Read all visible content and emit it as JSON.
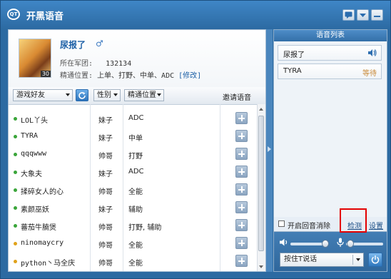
{
  "app": {
    "title": "开黑语音"
  },
  "profile": {
    "name": "尿报了",
    "gender_symbol": "♂",
    "level": "30",
    "team_label": "所在军团:",
    "team_value": "132134",
    "pos_label": "精通位置:",
    "pos_value": "上单、打野、中单、ADC",
    "edit_label": "[修改]"
  },
  "friends_header": {
    "friends_dropdown": "游戏好友",
    "gender_dropdown": "性别",
    "position_dropdown": "精通位置",
    "invite_label": "邀请语音"
  },
  "friends": [
    {
      "name": "LOL丫头",
      "gender": "妹子",
      "position": "ADC",
      "status": "online"
    },
    {
      "name": "TYRA",
      "gender": "妹子",
      "position": "中单",
      "status": "online"
    },
    {
      "name": "qqqwww",
      "gender": "帅哥",
      "position": "打野",
      "status": "online"
    },
    {
      "name": "大象夫",
      "gender": "妹子",
      "position": "ADC",
      "status": "online"
    },
    {
      "name": "揉碎女人的心",
      "gender": "帅哥",
      "position": "全能",
      "status": "online"
    },
    {
      "name": "素颜巫妖",
      "gender": "妹子",
      "position": "辅助",
      "status": "online"
    },
    {
      "name": "蕃茄牛腩煲",
      "gender": "帅哥",
      "position": "打野, 辅助",
      "status": "online"
    },
    {
      "name": "ninomaycry",
      "gender": "帅哥",
      "position": "全能",
      "status": "away"
    },
    {
      "name": "python丶马全庆",
      "gender": "帅哥",
      "position": "全能",
      "status": "away"
    }
  ],
  "voice_panel": {
    "title": "语音列表",
    "members": [
      {
        "name": "尿报了",
        "status": ""
      },
      {
        "name": "TYRA",
        "status": "等待"
      }
    ],
    "echo_cancel_label": "开启回音消除",
    "detect_label": "检测",
    "settings_label": "设置",
    "ptt_label": "按住T说话"
  },
  "colors": {
    "online": "#3aa53a",
    "away": "#e0a21a",
    "highlight": "#e30000"
  }
}
